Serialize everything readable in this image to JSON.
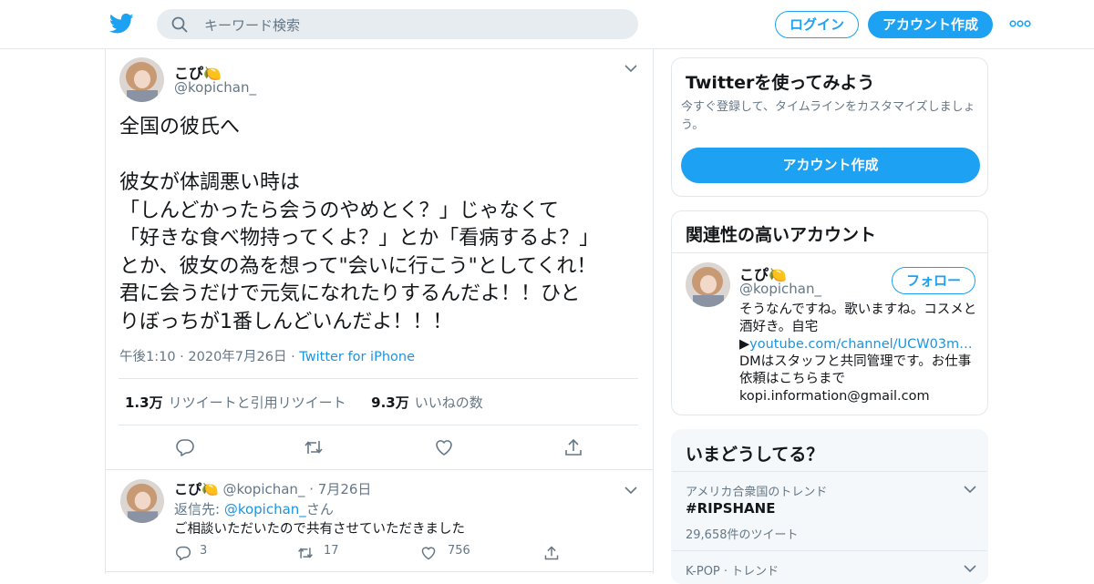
{
  "header": {
    "search_placeholder": "キーワード検索",
    "login_label": "ログイン",
    "signup_label": "アカウント作成"
  },
  "tweet": {
    "display_name": "こぴ🍋",
    "handle": "@kopichan_",
    "text": "全国の彼氏へ\n\n彼女が体調悪い時は\n「しんどかったら会うのやめとく？」じゃなくて\n「好きな食べ物持ってくよ？」とか「看病するよ？」\nとか、彼女の為を想って\"会いに行こう\"としてくれ！\n君に会うだけで元気になれたりするんだよ！！ひと\nりぼっちが1番しんどいんだよ！！！",
    "time": "午後1:10",
    "date": "2020年7月26日",
    "source": "Twitter for iPhone",
    "retweets_count": "1.3万",
    "retweets_label": "リツイートと引用リツイート",
    "likes_count": "9.3万",
    "likes_label": "いいねの数"
  },
  "reply": {
    "display_name": "こぴ🍋",
    "handle": "@kopichan_",
    "date": "7月26日",
    "replying_prefix": "返信先: ",
    "replying_to": "@kopichan_",
    "replying_suffix": "さん",
    "text": "ご相談いただいたので共有させていただきました",
    "reply_count": "3",
    "retweet_count": "17",
    "like_count": "756"
  },
  "sidebar": {
    "signup_card": {
      "title": "Twitterを使ってみよう",
      "subtitle": "今すぐ登録して、タイムラインをカスタマイズしましょう。",
      "button": "アカウント作成"
    },
    "related": {
      "title": "関連性の高いアカウント",
      "display_name": "こぴ🍋",
      "handle": "@kopichan_",
      "follow_label": "フォロー",
      "bio_line1": "そうなんですね。歌いますね。コスメと酒好き。自宅",
      "bio_link_prefix": "▶",
      "bio_link": "youtube.com/channel/UCW03m…",
      "bio_line2": "DMはスタッフと共同管理です。お仕事依頼はこちらまで",
      "bio_email": "kopi.information@gmail.com"
    },
    "trends": {
      "title": "いまどうしてる？",
      "items": [
        {
          "context": "アメリカ合衆国のトレンド",
          "name": "#RIPSHANE",
          "count": "29,658件のツイート"
        },
        {
          "context": "K-POP · トレンド"
        }
      ]
    }
  },
  "colors": {
    "brand": "#1da1f2",
    "link": "#1b95e0",
    "muted": "#657786",
    "border": "#e1e8ed"
  }
}
